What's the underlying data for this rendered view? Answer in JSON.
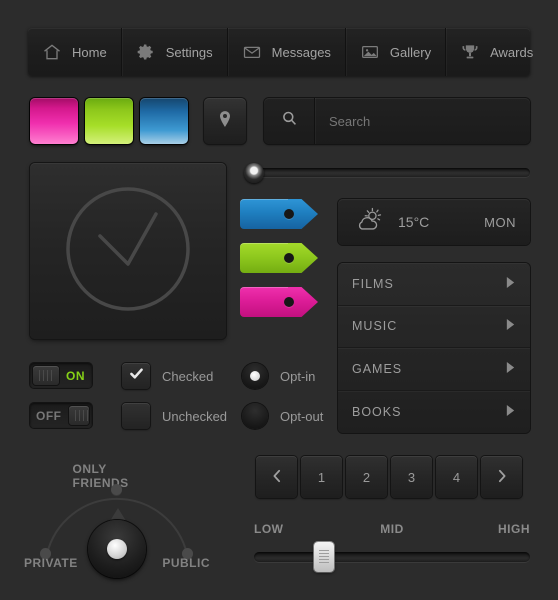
{
  "navbar": {
    "items": [
      {
        "icon": "home-icon",
        "label": "Home"
      },
      {
        "icon": "gear-icon",
        "label": "Settings"
      },
      {
        "icon": "envelope-icon",
        "label": "Messages"
      },
      {
        "icon": "image-icon",
        "label": "Gallery"
      },
      {
        "icon": "trophy-icon",
        "label": "Awards"
      }
    ]
  },
  "color_buttons": [
    {
      "name": "magenta-button",
      "color": "#e01fa0"
    },
    {
      "name": "green-button",
      "color": "#9ed424"
    },
    {
      "name": "blue-button",
      "color": "#2a87c8"
    }
  ],
  "pin_button": {
    "icon": "location-pin-icon"
  },
  "search": {
    "placeholder": "Search",
    "value": "",
    "icon": "search-icon"
  },
  "top_slider": {
    "value": 0,
    "min": 0,
    "max": 100
  },
  "big_panel": {
    "icon": "clock-check-icon"
  },
  "tags": [
    {
      "name": "tag-blue",
      "color": "#1f7fc0"
    },
    {
      "name": "tag-green",
      "color": "#8fc91e"
    },
    {
      "name": "tag-pink",
      "color": "#dd1d98"
    }
  ],
  "weather": {
    "icon": "sun-cloud-icon",
    "temperature": "15°C",
    "day": "MON"
  },
  "list": {
    "items": [
      {
        "label": "FILMS",
        "arrow": "chevron-right-icon"
      },
      {
        "label": "MUSIC",
        "arrow": "chevron-right-icon"
      },
      {
        "label": "GAMES",
        "arrow": "chevron-right-icon"
      },
      {
        "label": "BOOKS",
        "arrow": "chevron-right-icon"
      }
    ]
  },
  "toggles": [
    {
      "name": "toggle-on",
      "label": "ON",
      "state": "on",
      "color": "#86d117"
    },
    {
      "name": "toggle-off",
      "label": "OFF",
      "state": "off",
      "color": "#777777"
    }
  ],
  "checkboxes": [
    {
      "label": "Checked",
      "checked": true
    },
    {
      "label": "Unchecked",
      "checked": false
    }
  ],
  "radios": [
    {
      "label": "Opt-in",
      "selected": true
    },
    {
      "label": "Opt-out",
      "selected": false
    }
  ],
  "privacy_knob": {
    "top_label": "ONLY FRIENDS",
    "left_label": "PRIVATE",
    "right_label": "PUBLIC",
    "selected": "ONLY FRIENDS"
  },
  "pagination": {
    "prev": "‹",
    "next": "›",
    "pages": [
      "1",
      "2",
      "3",
      "4"
    ]
  },
  "bottom_slider": {
    "low": "LOW",
    "mid": "MID",
    "high": "HIGH",
    "value": 22
  }
}
